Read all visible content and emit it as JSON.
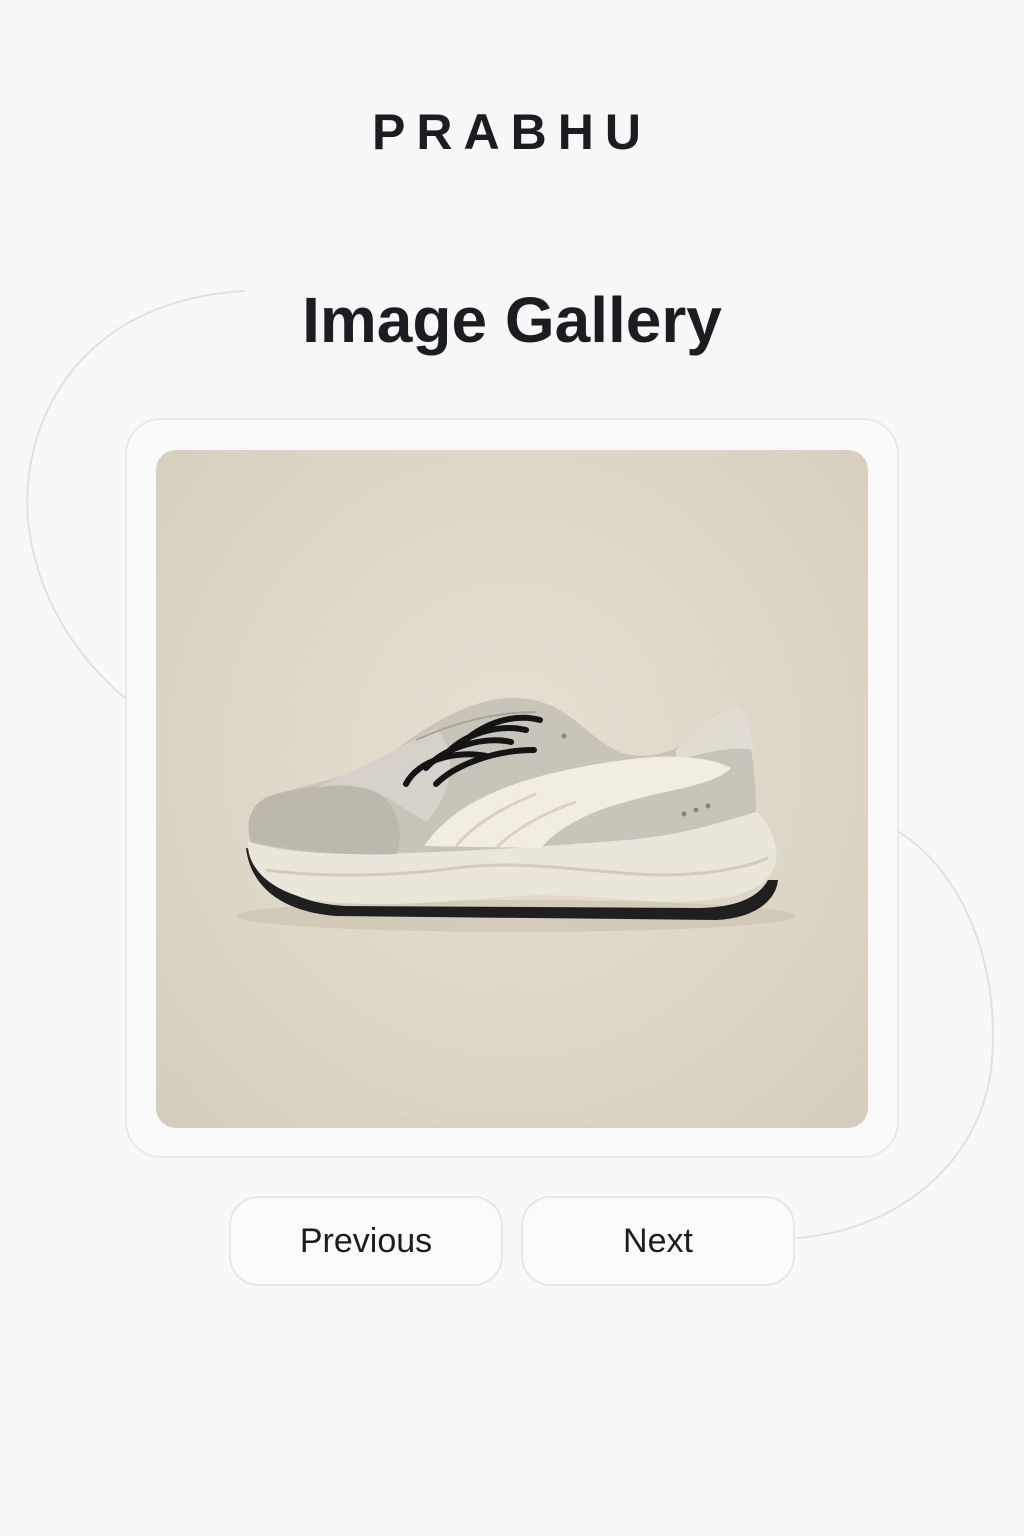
{
  "brand": {
    "name": "PRABHU"
  },
  "gallery": {
    "title": "Image Gallery",
    "current_image": {
      "subject": "sneaker-photo",
      "background_color": "#ddd6c6"
    }
  },
  "navigation": {
    "previous_label": "Previous",
    "next_label": "Next"
  },
  "colors": {
    "page_background": "#f8f8f8",
    "text": "#1a1d22",
    "border": "#e7e7e7"
  }
}
